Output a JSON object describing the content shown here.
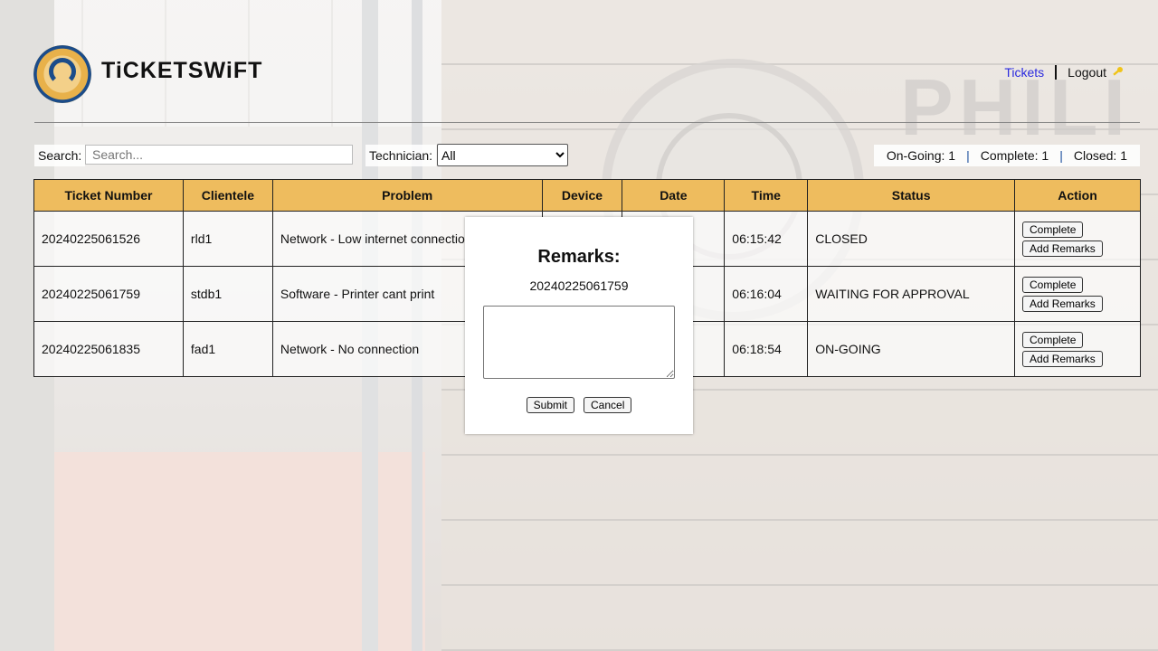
{
  "header": {
    "brand": "TiCKETSWiFT",
    "nav_tickets": "Tickets",
    "nav_logout": "Logout",
    "logout_icon": "key-icon",
    "link_color": "#2a2adf"
  },
  "controls": {
    "search_label": "Search:",
    "search_placeholder": "Search...",
    "technician_label": "Technician:",
    "technician_selected": "All",
    "ongoing": "On-Going: 1",
    "complete": "Complete: 1",
    "closed": "Closed: 1",
    "separator": "|"
  },
  "table": {
    "header_color": "#eebc5e",
    "columns": [
      "Ticket Number",
      "Clientele",
      "Problem",
      "Device",
      "Date",
      "Time",
      "Status",
      "Action"
    ],
    "rows": [
      {
        "ticket": "20240225061526",
        "client": "rld1",
        "problem": "Network - Low internet connection",
        "device": "",
        "date": "",
        "time": "06:15:42",
        "status": "CLOSED"
      },
      {
        "ticket": "20240225061759",
        "client": "stdb1",
        "problem": "Software - Printer cant print",
        "device": "",
        "date": "",
        "time": "06:16:04",
        "status": "WAITING FOR APPROVAL"
      },
      {
        "ticket": "20240225061835",
        "client": "fad1",
        "problem": "Network - No connection",
        "device": "",
        "date": "",
        "time": "06:18:54",
        "status": "ON-GOING"
      }
    ],
    "btn_complete": "Complete",
    "btn_remarks": "Add Remarks"
  },
  "modal": {
    "title": "Remarks:",
    "ticket": "20240225061759",
    "submit": "Submit",
    "cancel": "Cancel"
  }
}
